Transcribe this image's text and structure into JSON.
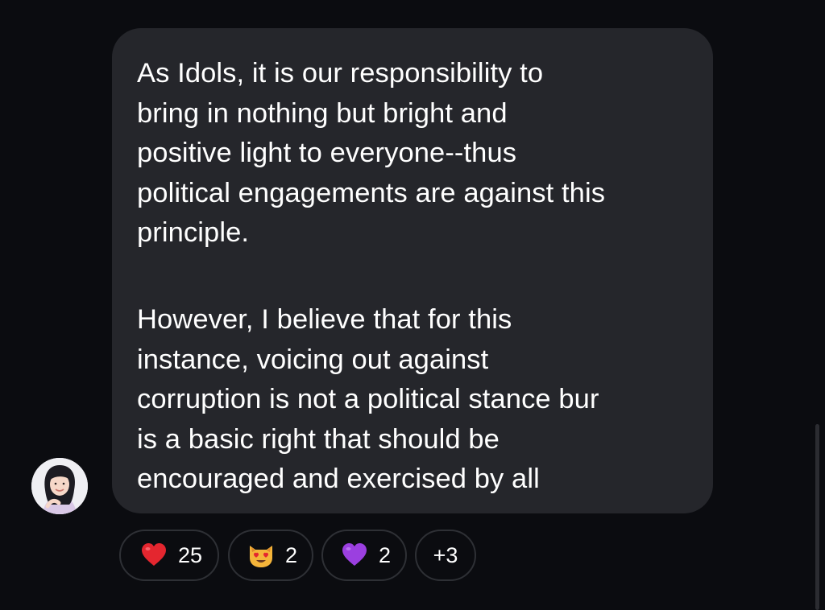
{
  "message": {
    "paragraph_1": "As Idols, it is our responsibility to\nbring in nothing but bright and\npositive light to everyone--thus\npolitical engagements are against this\nprinciple.",
    "paragraph_2": "However, I believe that for this\ninstance, voicing out against\ncorruption is not a political stance bur\nis a basic right that should be\nencouraged and exercised by all"
  },
  "reactions": [
    {
      "emoji": "red-heart",
      "count": "25"
    },
    {
      "emoji": "smiling-cat-heart-eyes",
      "count": "2"
    },
    {
      "emoji": "purple-heart",
      "count": "2"
    }
  ],
  "more_reactions": "+3",
  "colors": {
    "background": "#0b0c10",
    "bubble": "#25262b",
    "chip_border": "#2e3035",
    "text": "#ffffff"
  }
}
